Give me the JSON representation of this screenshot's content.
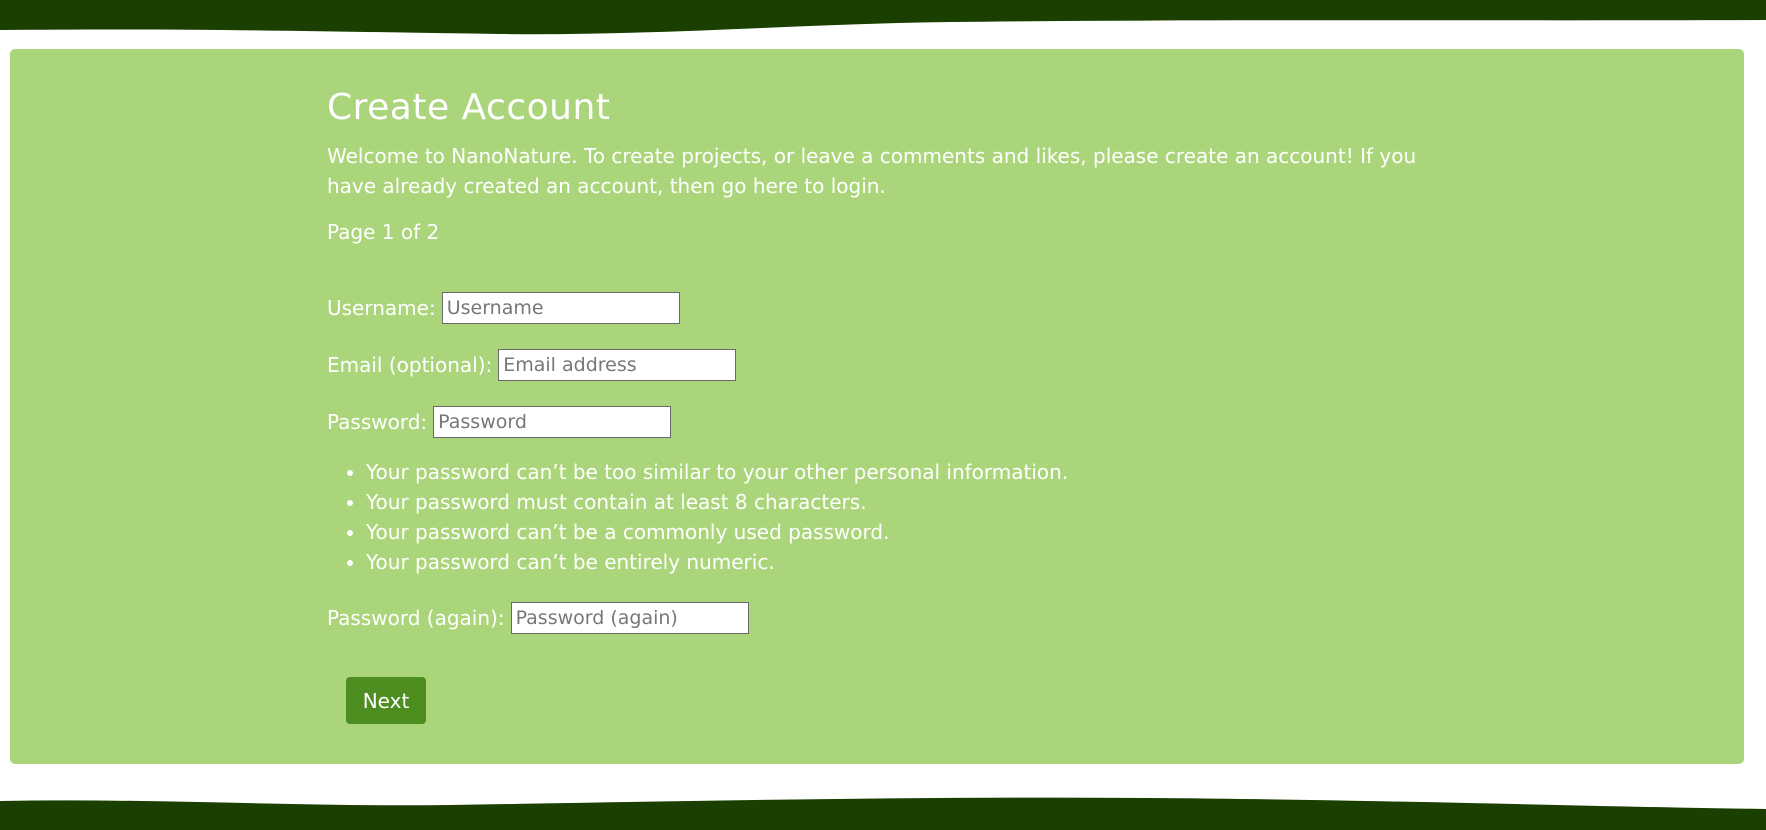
{
  "colors": {
    "header_band": "#1a3f00",
    "panel_background": "#abd57a",
    "button_background": "#4e8e20",
    "text": "#ffffff"
  },
  "page": {
    "title": "Create Account",
    "intro": "Welcome to NanoNature. To create projects, or leave a comments and likes, please create an account! If you have already created an account, then go here to login.",
    "page_indicator": "Page 1 of 2"
  },
  "form": {
    "username": {
      "label": "Username:",
      "placeholder": "Username",
      "value": ""
    },
    "email": {
      "label": "Email (optional):",
      "placeholder": "Email address",
      "value": ""
    },
    "password": {
      "label": "Password:",
      "placeholder": "Password",
      "value": ""
    },
    "password_rules": [
      "Your password can’t be too similar to your other personal information.",
      "Your password must contain at least 8 characters.",
      "Your password can’t be a commonly used password.",
      "Your password can’t be entirely numeric."
    ],
    "password_again": {
      "label": "Password (again):",
      "placeholder": "Password (again)",
      "value": ""
    },
    "next_label": "Next"
  }
}
